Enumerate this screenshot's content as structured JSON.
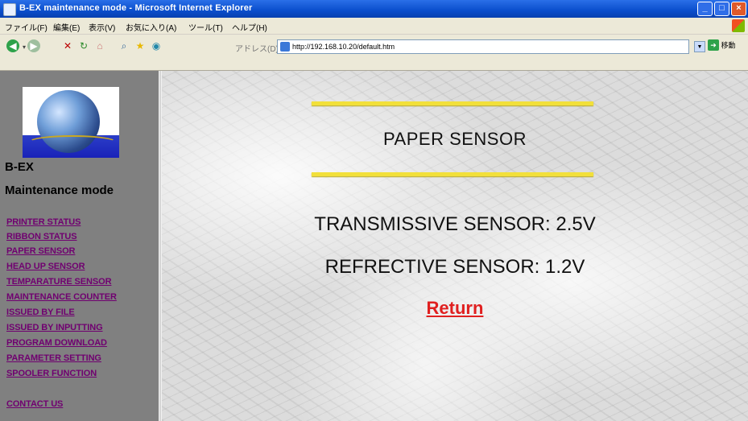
{
  "window": {
    "title": "B-EX maintenance mode - Microsoft Internet Explorer"
  },
  "menubar": {
    "items": [
      "ファイル(F)",
      "編集(E)",
      "表示(V)",
      "お気に入り(A)",
      "ツール(T)",
      "ヘルプ(H)"
    ]
  },
  "toolbar": {
    "address_label": "アドレス(D)",
    "address_value": "http://192.168.10.20/default.htm",
    "go_label": "移動"
  },
  "sidebar": {
    "brand_line1": "B-EX",
    "brand_line2": "Maintenance mode",
    "links": [
      "PRINTER STATUS",
      "RIBBON STATUS",
      "PAPER SENSOR",
      "HEAD UP SENSOR",
      "TEMPARATURE SENSOR",
      "MAINTENANCE COUNTER",
      "ISSUED BY FILE",
      "ISSUED BY INPUTTING",
      "PROGRAM DOWNLOAD",
      "PARAMETER SETTING",
      "SPOOLER FUNCTION"
    ],
    "contact": "CONTACT US"
  },
  "main": {
    "heading": "PAPER SENSOR",
    "transmissive": "TRANSMISSIVE SENSOR: 2.5V",
    "reflective": "REFRECTIVE SENSOR: 1.2V",
    "return_label": "Return"
  },
  "colors": {
    "link": "#700070",
    "return": "#e02020",
    "rule": "#f2e03a",
    "sidebar": "#808080"
  }
}
